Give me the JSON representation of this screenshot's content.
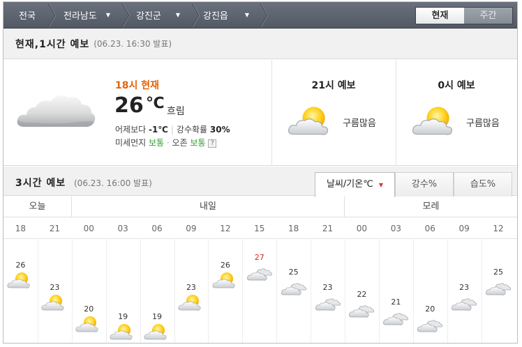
{
  "nav": {
    "breadcrumbs": [
      {
        "label": "전국",
        "has_dropdown": false
      },
      {
        "label": "전라남도",
        "has_dropdown": true
      },
      {
        "label": "강진군",
        "has_dropdown": true
      },
      {
        "label": "강진읍",
        "has_dropdown": true
      }
    ],
    "tabs": [
      {
        "label": "현재",
        "active": true
      },
      {
        "label": "주간",
        "active": false
      }
    ]
  },
  "current_section": {
    "title": "현재,1시간 예보",
    "issued": "(06.23. 16:30 발표)"
  },
  "current": {
    "time_label": "18시 현재",
    "temp": "26",
    "unit": "℃",
    "condition": "흐림",
    "icon": "cloudy-icon",
    "yesterday_label": "어제보다",
    "yesterday_diff": "-1℃",
    "rain_label": "강수확률",
    "rain_value": "30%",
    "dust_label": "미세먼지",
    "dust_value": "보통",
    "ozone_label": "오존",
    "ozone_value": "보통",
    "help": "?"
  },
  "hourly_forecast": [
    {
      "title": "21시 예보",
      "condition": "구름많음",
      "icon": "partly-cloudy-icon"
    },
    {
      "title": "0시 예보",
      "condition": "구름많음",
      "icon": "partly-cloudy-icon"
    }
  ],
  "three_hour_section": {
    "title": "3시간 예보",
    "issued": "(06.23. 16:00 발표)",
    "tabs": [
      {
        "label": "날씨/기온℃",
        "active": true
      },
      {
        "label": "강수%",
        "active": false
      },
      {
        "label": "습도%",
        "active": false
      }
    ]
  },
  "days": [
    "오늘",
    "내일",
    "모레"
  ],
  "three_hour": [
    {
      "hour": "18",
      "temp": 26,
      "icon": "partly-cloudy-icon",
      "highlight": false
    },
    {
      "hour": "21",
      "temp": 23,
      "icon": "partly-cloudy-icon",
      "highlight": false
    },
    {
      "hour": "00",
      "temp": 20,
      "icon": "partly-cloudy-icon",
      "highlight": false
    },
    {
      "hour": "03",
      "temp": 19,
      "icon": "partly-cloudy-icon",
      "highlight": false
    },
    {
      "hour": "06",
      "temp": 19,
      "icon": "partly-cloudy-icon",
      "highlight": false
    },
    {
      "hour": "09",
      "temp": 23,
      "icon": "partly-cloudy-icon",
      "highlight": false
    },
    {
      "hour": "12",
      "temp": 26,
      "icon": "partly-cloudy-icon",
      "highlight": false
    },
    {
      "hour": "15",
      "temp": 27,
      "icon": "cloudy-icon",
      "highlight": true
    },
    {
      "hour": "18",
      "temp": 25,
      "icon": "cloudy-icon",
      "highlight": false
    },
    {
      "hour": "21",
      "temp": 23,
      "icon": "cloudy-icon",
      "highlight": false
    },
    {
      "hour": "00",
      "temp": 22,
      "icon": "cloudy-icon",
      "highlight": false
    },
    {
      "hour": "03",
      "temp": 21,
      "icon": "cloudy-icon",
      "highlight": false
    },
    {
      "hour": "06",
      "temp": 20,
      "icon": "cloudy-icon",
      "highlight": false
    },
    {
      "hour": "09",
      "temp": 23,
      "icon": "cloudy-icon",
      "highlight": false
    },
    {
      "hour": "12",
      "temp": 25,
      "icon": "cloudy-icon",
      "highlight": false
    }
  ],
  "colors": {
    "accent_orange": "#e2650a",
    "good_green": "#2f9a2f",
    "max_red": "#d22222",
    "nav_bg": "#5e6570"
  }
}
